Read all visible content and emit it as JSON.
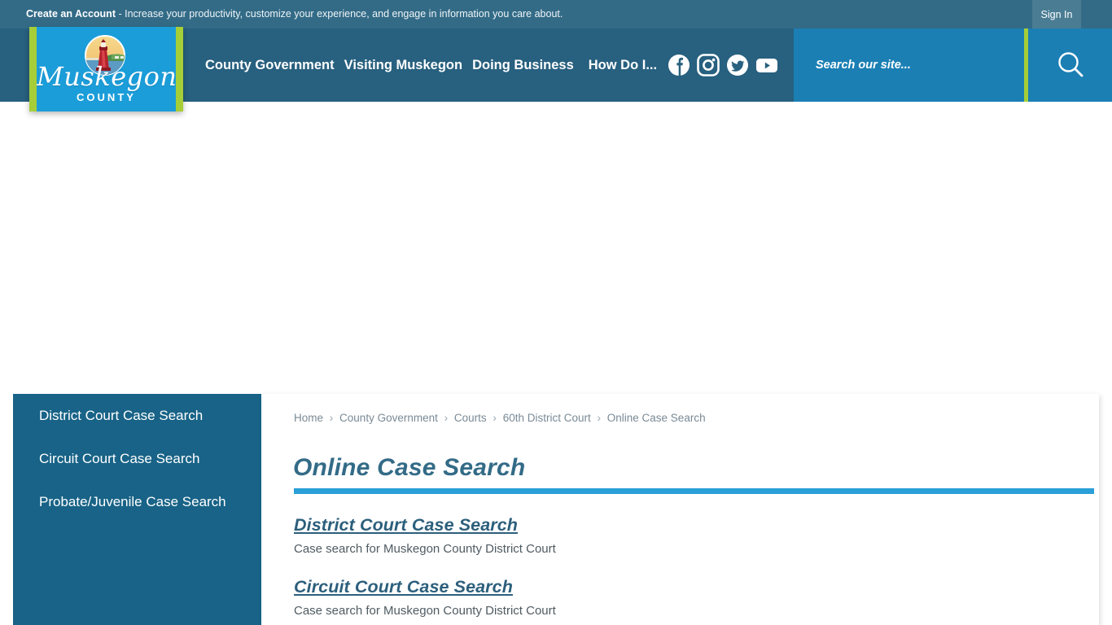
{
  "topbar": {
    "cta_bold": "Create an Account",
    "cta_rest": " - Increase your productivity, customize your experience, and engage in information you care about.",
    "signin_label": "Sign In"
  },
  "logo": {
    "script_text": "Muskegon",
    "county_text": "COUNTY",
    "emblem_name": "lighthouse-emblem"
  },
  "nav": {
    "items": [
      {
        "label": "County Government"
      },
      {
        "label": "Visiting Muskegon"
      },
      {
        "label": "Doing Business"
      },
      {
        "label": "How Do I..."
      }
    ]
  },
  "social": {
    "items": [
      {
        "name": "facebook-icon"
      },
      {
        "name": "instagram-icon"
      },
      {
        "name": "twitter-icon"
      },
      {
        "name": "youtube-icon"
      }
    ]
  },
  "search": {
    "placeholder": "Search our site...",
    "value": "",
    "button_name": "search-icon"
  },
  "sidebar": {
    "items": [
      {
        "label": "District Court Case Search"
      },
      {
        "label": "Circuit Court Case Search"
      },
      {
        "label": "Probate/Juvenile Case Search"
      }
    ]
  },
  "main": {
    "breadcrumb": [
      "Home",
      "County Government",
      "Courts",
      "60th District Court",
      "Online Case Search"
    ],
    "breadcrumb_separator": "›",
    "page_title": "Online Case Search",
    "links": [
      {
        "label": "District Court Case Search",
        "description": "Case search for Muskegon County District Court"
      },
      {
        "label": "Circuit Court Case Search",
        "description": "Case search for Muskegon County District Court"
      }
    ]
  },
  "colors": {
    "topbar_bg": "#336b87",
    "header_bg": "#28607f",
    "search_bg": "#1b7fb4",
    "accent_green": "#a6ce39",
    "logo_blue": "#1b9dd9",
    "sidebar_bg": "#186387",
    "rule_blue": "#2a9fd8",
    "title_color": "#336b87",
    "link_color": "#2c5f7c"
  }
}
